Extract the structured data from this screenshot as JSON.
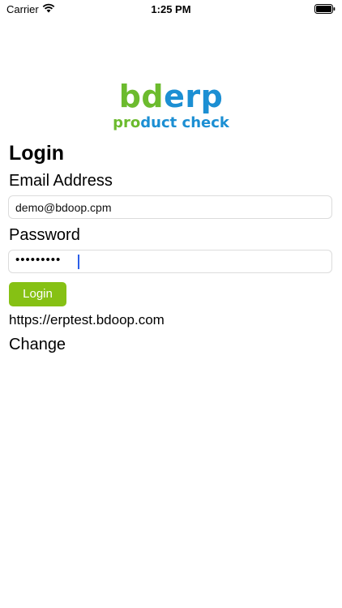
{
  "status_bar": {
    "carrier": "Carrier",
    "time": "1:25 PM",
    "wifi_icon": "wifi-icon",
    "battery_icon": "battery-icon"
  },
  "logo": {
    "main_part1": "bd",
    "main_part2": "erp",
    "sub_part1": "pro",
    "sub_part2": "duct check",
    "colors": {
      "green": "#6cbb2e",
      "blue": "#1c8fd3"
    }
  },
  "form": {
    "title": "Login",
    "email_label": "Email Address",
    "email_value": "demo@bdoop.cpm",
    "password_label": "Password",
    "password_value_masked": "•••••••••",
    "login_button": "Login",
    "login_button_color": "#86c114",
    "server_url": "https://erptest.bdoop.com",
    "change_link": "Change"
  }
}
